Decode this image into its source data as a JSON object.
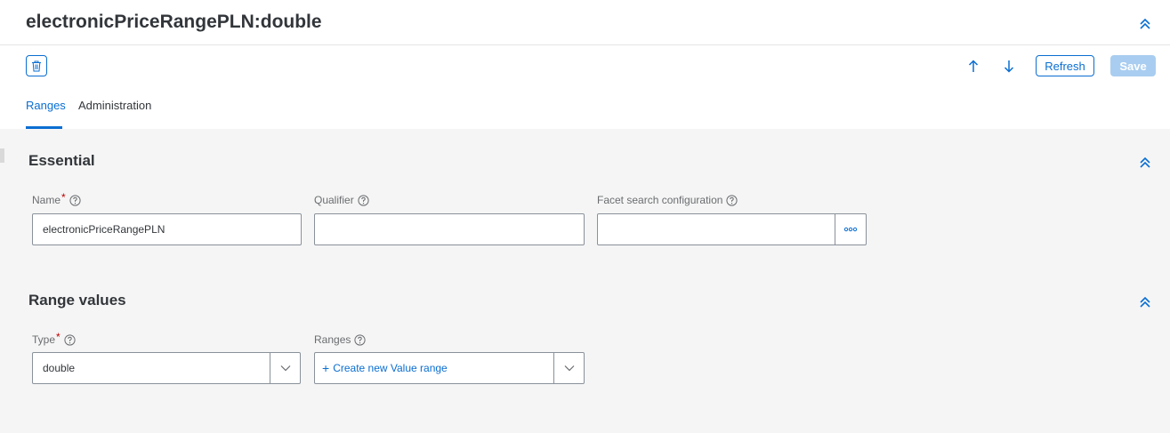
{
  "header": {
    "title": "electronicPriceRangePLN:double",
    "refresh_label": "Refresh",
    "save_label": "Save"
  },
  "tabs": [
    {
      "label": "Ranges",
      "active": true
    },
    {
      "label": "Administration",
      "active": false
    }
  ],
  "sections": {
    "essential": {
      "title": "Essential",
      "fields": {
        "name": {
          "label": "Name",
          "required": true,
          "value": "electronicPriceRangePLN"
        },
        "qualifier": {
          "label": "Qualifier",
          "value": ""
        },
        "facet": {
          "label": "Facet search configuration",
          "value": ""
        }
      }
    },
    "range_values": {
      "title": "Range values",
      "fields": {
        "type": {
          "label": "Type",
          "required": true,
          "value": "double"
        },
        "ranges": {
          "label": "Ranges",
          "action_label": "Create new Value range"
        }
      }
    }
  },
  "icons": {
    "collapse": "chevron-double-up-icon",
    "delete": "trash-icon",
    "move_up": "arrow-up-icon",
    "move_down": "arrow-down-icon",
    "help": "question-circle-icon",
    "value_help": "ellipsis-icon",
    "dropdown": "chevron-down-icon"
  },
  "colors": {
    "accent": "#0a6ed1",
    "text": "#32363a",
    "required": "#bb0000",
    "save_disabled": "#a9cdf0",
    "background": "#f5f5f5"
  }
}
